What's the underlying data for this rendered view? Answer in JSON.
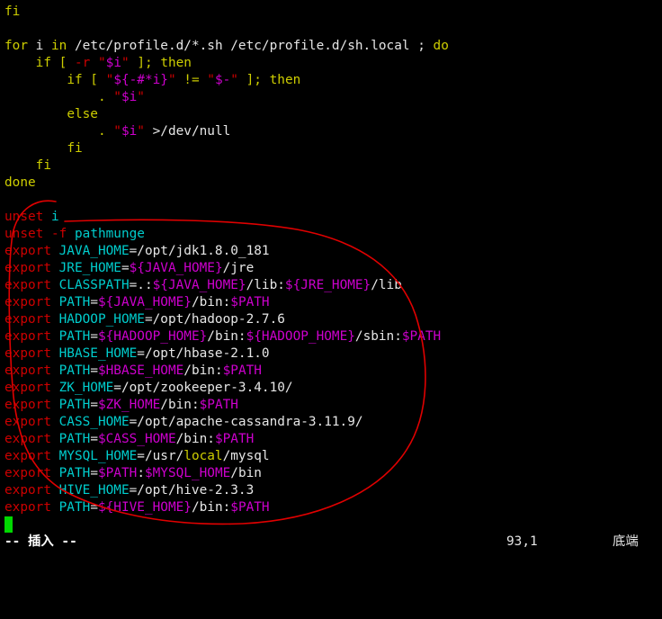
{
  "colors": {
    "background": "#000000",
    "keyword": "#cdcd00",
    "command": "#cd0000",
    "variable": "#cd00cd",
    "string_quote": "#cdcd00",
    "normal": "#e6e6e6",
    "cyan": "#00cdcd",
    "cursor": "#00d800",
    "annotation_circle": "#e00000"
  },
  "editor": {
    "lines": [
      [
        {
          "t": "fi",
          "c": "keyword"
        }
      ],
      [],
      [
        {
          "t": "for",
          "c": "keyword"
        },
        {
          "t": " i ",
          "c": "normal"
        },
        {
          "t": "in",
          "c": "keyword"
        },
        {
          "t": " /etc/profile.d/*.sh /etc/profile.d/sh.local ; ",
          "c": "normal"
        },
        {
          "t": "do",
          "c": "keyword"
        }
      ],
      [
        {
          "t": "    ",
          "c": "normal"
        },
        {
          "t": "if",
          "c": "keyword"
        },
        {
          "t": " [ ",
          "c": "keyword"
        },
        {
          "t": "-r",
          "c": "command"
        },
        {
          "t": " ",
          "c": "normal"
        },
        {
          "t": "\"",
          "c": "command"
        },
        {
          "t": "$i",
          "c": "variable"
        },
        {
          "t": "\"",
          "c": "command"
        },
        {
          "t": " ]; ",
          "c": "keyword"
        },
        {
          "t": "then",
          "c": "keyword"
        }
      ],
      [
        {
          "t": "        ",
          "c": "normal"
        },
        {
          "t": "if",
          "c": "keyword"
        },
        {
          "t": " [ ",
          "c": "keyword"
        },
        {
          "t": "\"",
          "c": "command"
        },
        {
          "t": "${-#*i}",
          "c": "variable"
        },
        {
          "t": "\"",
          "c": "command"
        },
        {
          "t": " != ",
          "c": "keyword"
        },
        {
          "t": "\"",
          "c": "command"
        },
        {
          "t": "$-",
          "c": "variable"
        },
        {
          "t": "\"",
          "c": "command"
        },
        {
          "t": " ]; ",
          "c": "keyword"
        },
        {
          "t": "then",
          "c": "keyword"
        }
      ],
      [
        {
          "t": "            . ",
          "c": "keyword"
        },
        {
          "t": "\"",
          "c": "command"
        },
        {
          "t": "$i",
          "c": "variable"
        },
        {
          "t": "\"",
          "c": "command"
        }
      ],
      [
        {
          "t": "        ",
          "c": "normal"
        },
        {
          "t": "else",
          "c": "keyword"
        }
      ],
      [
        {
          "t": "            . ",
          "c": "keyword"
        },
        {
          "t": "\"",
          "c": "command"
        },
        {
          "t": "$i",
          "c": "variable"
        },
        {
          "t": "\"",
          "c": "command"
        },
        {
          "t": " >/dev/null",
          "c": "normal"
        }
      ],
      [
        {
          "t": "        ",
          "c": "normal"
        },
        {
          "t": "fi",
          "c": "keyword"
        }
      ],
      [
        {
          "t": "    ",
          "c": "normal"
        },
        {
          "t": "fi",
          "c": "keyword"
        }
      ],
      [
        {
          "t": "done",
          "c": "keyword"
        }
      ],
      [],
      [
        {
          "t": "unset",
          "c": "command"
        },
        {
          "t": " i",
          "c": "cyan"
        }
      ],
      [
        {
          "t": "unset",
          "c": "command"
        },
        {
          "t": " -f",
          "c": "command"
        },
        {
          "t": " pathmunge",
          "c": "cyan"
        }
      ],
      [
        {
          "t": "export",
          "c": "command"
        },
        {
          "t": " JAVA_HOME",
          "c": "cyan"
        },
        {
          "t": "=/opt/jdk1.8.0_181",
          "c": "normal"
        }
      ],
      [
        {
          "t": "export",
          "c": "command"
        },
        {
          "t": " JRE_HOME",
          "c": "cyan"
        },
        {
          "t": "=",
          "c": "normal"
        },
        {
          "t": "${JAVA_HOME}",
          "c": "variable"
        },
        {
          "t": "/jre",
          "c": "normal"
        }
      ],
      [
        {
          "t": "export",
          "c": "command"
        },
        {
          "t": " CLASSPATH",
          "c": "cyan"
        },
        {
          "t": "=.:",
          "c": "normal"
        },
        {
          "t": "${JAVA_HOME}",
          "c": "variable"
        },
        {
          "t": "/lib:",
          "c": "normal"
        },
        {
          "t": "${JRE_HOME}",
          "c": "variable"
        },
        {
          "t": "/lib",
          "c": "normal"
        }
      ],
      [
        {
          "t": "export",
          "c": "command"
        },
        {
          "t": " PATH",
          "c": "cyan"
        },
        {
          "t": "=",
          "c": "normal"
        },
        {
          "t": "${JAVA_HOME}",
          "c": "variable"
        },
        {
          "t": "/bin:",
          "c": "normal"
        },
        {
          "t": "$PATH",
          "c": "variable"
        }
      ],
      [
        {
          "t": "export",
          "c": "command"
        },
        {
          "t": " HADOOP_HOME",
          "c": "cyan"
        },
        {
          "t": "=/opt/hadoop-2.7.6",
          "c": "normal"
        }
      ],
      [
        {
          "t": "export",
          "c": "command"
        },
        {
          "t": " PATH",
          "c": "cyan"
        },
        {
          "t": "=",
          "c": "normal"
        },
        {
          "t": "${HADOOP_HOME}",
          "c": "variable"
        },
        {
          "t": "/bin:",
          "c": "normal"
        },
        {
          "t": "${HADOOP_HOME}",
          "c": "variable"
        },
        {
          "t": "/sbin:",
          "c": "normal"
        },
        {
          "t": "$PATH",
          "c": "variable"
        }
      ],
      [
        {
          "t": "export",
          "c": "command"
        },
        {
          "t": " HBASE_HOME",
          "c": "cyan"
        },
        {
          "t": "=/opt/hbase-2.1.0",
          "c": "normal"
        }
      ],
      [
        {
          "t": "export",
          "c": "command"
        },
        {
          "t": " PATH",
          "c": "cyan"
        },
        {
          "t": "=",
          "c": "normal"
        },
        {
          "t": "$HBASE_HOME",
          "c": "variable"
        },
        {
          "t": "/bin:",
          "c": "normal"
        },
        {
          "t": "$PATH",
          "c": "variable"
        }
      ],
      [
        {
          "t": "export",
          "c": "command"
        },
        {
          "t": " ZK_HOME",
          "c": "cyan"
        },
        {
          "t": "=/opt/zookeeper-3.4.10/",
          "c": "normal"
        }
      ],
      [
        {
          "t": "export",
          "c": "command"
        },
        {
          "t": " PATH",
          "c": "cyan"
        },
        {
          "t": "=",
          "c": "normal"
        },
        {
          "t": "$ZK_HOME",
          "c": "variable"
        },
        {
          "t": "/bin:",
          "c": "normal"
        },
        {
          "t": "$PATH",
          "c": "variable"
        }
      ],
      [
        {
          "t": "export",
          "c": "command"
        },
        {
          "t": " CASS_HOME",
          "c": "cyan"
        },
        {
          "t": "=/opt/apache-cassandra-3.11.9/",
          "c": "normal"
        }
      ],
      [
        {
          "t": "export",
          "c": "command"
        },
        {
          "t": " PATH",
          "c": "cyan"
        },
        {
          "t": "=",
          "c": "normal"
        },
        {
          "t": "$CASS_HOME",
          "c": "variable"
        },
        {
          "t": "/bin:",
          "c": "normal"
        },
        {
          "t": "$PATH",
          "c": "variable"
        }
      ],
      [
        {
          "t": "export",
          "c": "command"
        },
        {
          "t": " MYSQL_HOME",
          "c": "cyan"
        },
        {
          "t": "=/usr/",
          "c": "normal"
        },
        {
          "t": "local",
          "c": "keyword"
        },
        {
          "t": "/mysql",
          "c": "normal"
        }
      ],
      [
        {
          "t": "export",
          "c": "command"
        },
        {
          "t": " PATH",
          "c": "cyan"
        },
        {
          "t": "=",
          "c": "normal"
        },
        {
          "t": "$PATH",
          "c": "variable"
        },
        {
          "t": ":",
          "c": "normal"
        },
        {
          "t": "$MYSQL_HOME",
          "c": "variable"
        },
        {
          "t": "/bin",
          "c": "normal"
        }
      ],
      [
        {
          "t": "export",
          "c": "command"
        },
        {
          "t": " HIVE_HOME",
          "c": "cyan"
        },
        {
          "t": "=/opt/hive-2.3.3",
          "c": "normal"
        }
      ],
      [
        {
          "t": "export",
          "c": "command"
        },
        {
          "t": " PATH",
          "c": "cyan"
        },
        {
          "t": "=",
          "c": "normal"
        },
        {
          "t": "${HIVE_HOME}",
          "c": "variable"
        },
        {
          "t": "/bin:",
          "c": "normal"
        },
        {
          "t": "$PATH",
          "c": "variable"
        }
      ]
    ]
  },
  "status": {
    "mode": "-- 插入 --",
    "position": "93,1",
    "scroll": "底端"
  }
}
